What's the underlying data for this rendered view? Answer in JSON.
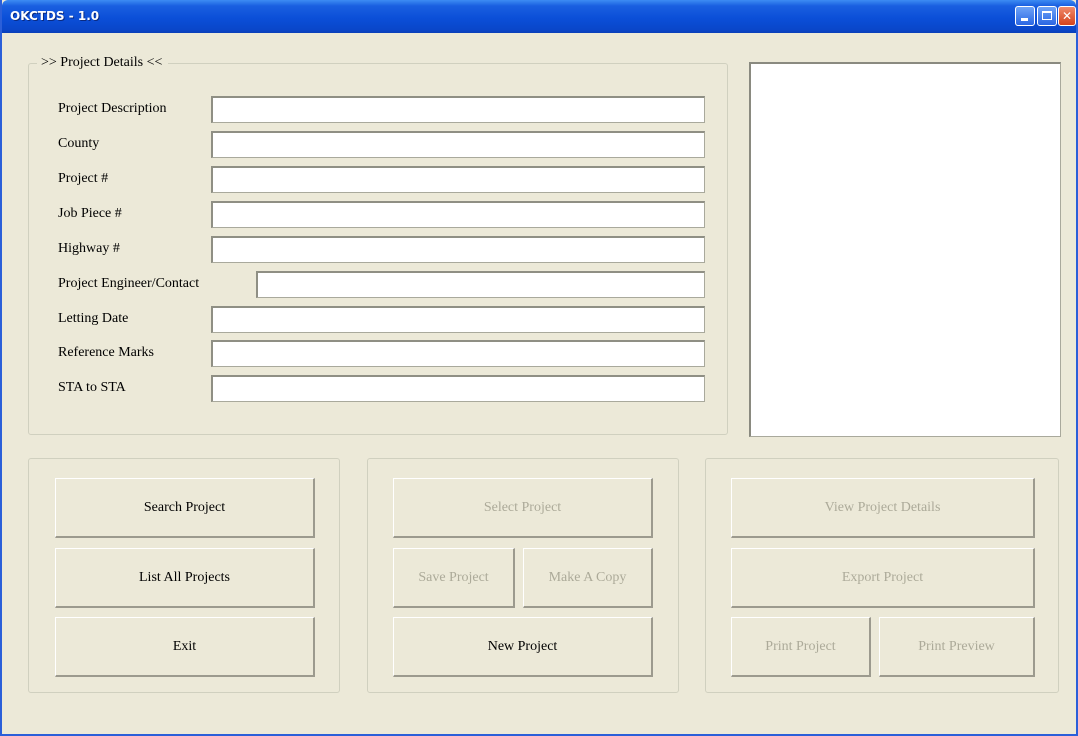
{
  "window": {
    "title": "OKCTDS - 1.0"
  },
  "project_details": {
    "legend": ">> Project Details <<",
    "fields": {
      "description": {
        "label": "Project Description",
        "value": ""
      },
      "county": {
        "label": "County",
        "value": ""
      },
      "project_no": {
        "label": "Project #",
        "value": ""
      },
      "job_piece": {
        "label": "Job Piece #",
        "value": ""
      },
      "highway": {
        "label": "Highway #",
        "value": ""
      },
      "engineer": {
        "label": "Project Engineer/Contact",
        "value": ""
      },
      "letting_date": {
        "label": "Letting Date",
        "value": ""
      },
      "reference_marks": {
        "label": "Reference Marks",
        "value": ""
      },
      "sta_to_sta": {
        "label": "STA to STA",
        "value": ""
      }
    }
  },
  "left_buttons": {
    "search": "Search Project",
    "list_all": "List All Projects",
    "exit": "Exit"
  },
  "middle_buttons": {
    "select": "Select Project",
    "save": "Save Project",
    "make_copy": "Make A Copy",
    "new": "New Project"
  },
  "right_buttons": {
    "view_details": "View Project Details",
    "export": "Export Project",
    "print": "Print Project",
    "print_preview": "Print Preview"
  },
  "colors": {
    "titlebar": "#0b4fd8",
    "window_bg": "#ece9d8",
    "disabled_text": "#acaa99"
  }
}
